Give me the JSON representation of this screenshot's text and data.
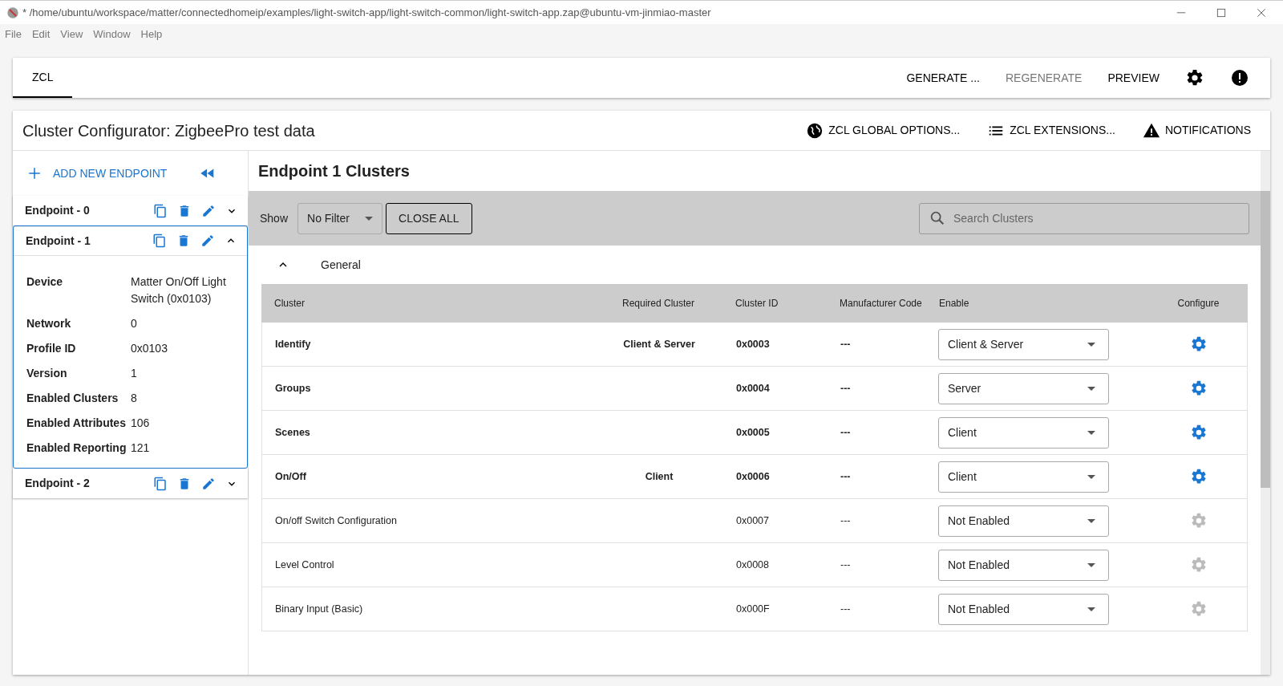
{
  "window": {
    "title": "* /home/ubuntu/workspace/matter/connectedhomeip/examples/light-switch-app/light-switch-common/light-switch-app.zap@ubuntu-vm-jinmiao-master"
  },
  "menu": [
    "File",
    "Edit",
    "View",
    "Window",
    "Help"
  ],
  "tabs": [
    {
      "label": "ZCL",
      "selected": true
    }
  ],
  "toolbar": [
    {
      "label": "GENERATE ...",
      "disabled": false
    },
    {
      "label": "REGENERATE",
      "disabled": true
    },
    {
      "label": "PREVIEW",
      "disabled": false
    }
  ],
  "page_title": "Cluster Configurator: ZigbeePro test data",
  "header_actions": [
    {
      "kind": "globe",
      "label": "ZCL GLOBAL OPTIONS..."
    },
    {
      "kind": "list",
      "label": "ZCL EXTENSIONS..."
    },
    {
      "kind": "warning",
      "label": "NOTIFICATIONS"
    }
  ],
  "add_endpoint": "ADD NEW ENDPOINT",
  "endpoints": [
    {
      "name": "Endpoint - 0",
      "expanded": false
    },
    {
      "name": "Endpoint - 1",
      "expanded": true,
      "details": [
        {
          "label": "Device",
          "value": "Matter On/Off Light Switch (0x0103)"
        },
        {
          "label": "Network",
          "value": "0"
        },
        {
          "label": "Profile ID",
          "value": "0x0103"
        },
        {
          "label": "Version",
          "value": "1"
        },
        {
          "label": "Enabled Clusters",
          "value": "8"
        },
        {
          "label": "Enabled Attributes",
          "value": "106"
        },
        {
          "label": "Enabled Reporting",
          "value": "121"
        }
      ]
    },
    {
      "name": "Endpoint - 2",
      "expanded": false
    }
  ],
  "content_title": "Endpoint 1 Clusters",
  "filter": {
    "label": "Show",
    "value": "No Filter",
    "close_all": "CLOSE ALL",
    "search_placeholder": "Search Clusters"
  },
  "group": {
    "name": "General",
    "expanded": true
  },
  "table": {
    "columns": [
      "Cluster",
      "Required Cluster",
      "Cluster ID",
      "Manufacturer Code",
      "Enable",
      "Configure"
    ],
    "rows": [
      {
        "cluster": "Identify",
        "required": "Client & Server",
        "id": "0x0003",
        "mfg": "---",
        "enable": "Client & Server",
        "enabled": true
      },
      {
        "cluster": "Groups",
        "id": "0x0004",
        "mfg": "---",
        "enable": "Server",
        "enabled": true
      },
      {
        "cluster": "Scenes",
        "id": "0x0005",
        "mfg": "---",
        "enable": "Client",
        "enabled": true
      },
      {
        "cluster": "On/Off",
        "required": "Client",
        "id": "0x0006",
        "mfg": "---",
        "enable": "Client",
        "enabled": true
      },
      {
        "cluster": "On/off Switch Configuration",
        "id": "0x0007",
        "mfg": "---",
        "enable": "Not Enabled",
        "enabled": false
      },
      {
        "cluster": "Level Control",
        "id": "0x0008",
        "mfg": "---",
        "enable": "Not Enabled",
        "enabled": false
      },
      {
        "cluster": "Binary Input (Basic)",
        "id": "0x000F",
        "mfg": "---",
        "enable": "Not Enabled",
        "enabled": false
      }
    ]
  }
}
